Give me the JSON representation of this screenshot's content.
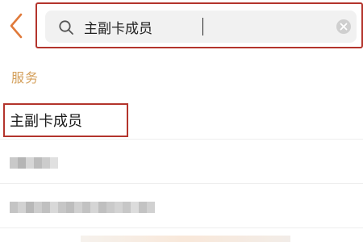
{
  "header": {
    "back_icon": "chevron-left-icon",
    "accent_color": "#e07a3a"
  },
  "search": {
    "value": "主副卡成员",
    "search_icon": "search-icon",
    "clear_icon": "clear-icon"
  },
  "section": {
    "label": "服务",
    "color": "#d4a05c"
  },
  "results": [
    {
      "label": "主副卡成员",
      "highlighted": true
    },
    {
      "label": "",
      "blurred": true
    },
    {
      "label": "",
      "blurred": true
    }
  ],
  "annotation_color": "#b3342c"
}
